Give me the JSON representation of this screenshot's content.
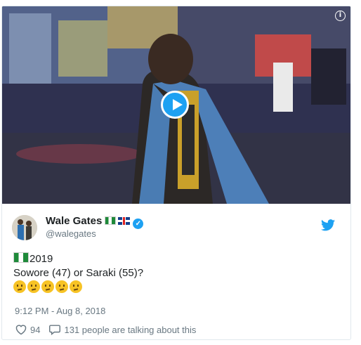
{
  "media": {
    "info_glyph": "i",
    "play_icon": "play-icon"
  },
  "author": {
    "display_name": "Wale Gates",
    "handle": "@walegates",
    "verified": true,
    "flags": [
      "nigeria-flag",
      "uk-flag"
    ]
  },
  "tweet": {
    "line1_year": "2019",
    "line1_flag": "nigeria-flag",
    "line2": "Sowore (47) or Saraki (55)?",
    "emoji_count": 5,
    "emoji_name": "thinking-face-emoji"
  },
  "timestamp": "9:12 PM - Aug 8, 2018",
  "actions": {
    "likes": "94",
    "conversation": "131 people are talking about this"
  },
  "colors": {
    "twitter_blue": "#1da1f2",
    "text": "#1c2022",
    "muted": "#697882"
  }
}
